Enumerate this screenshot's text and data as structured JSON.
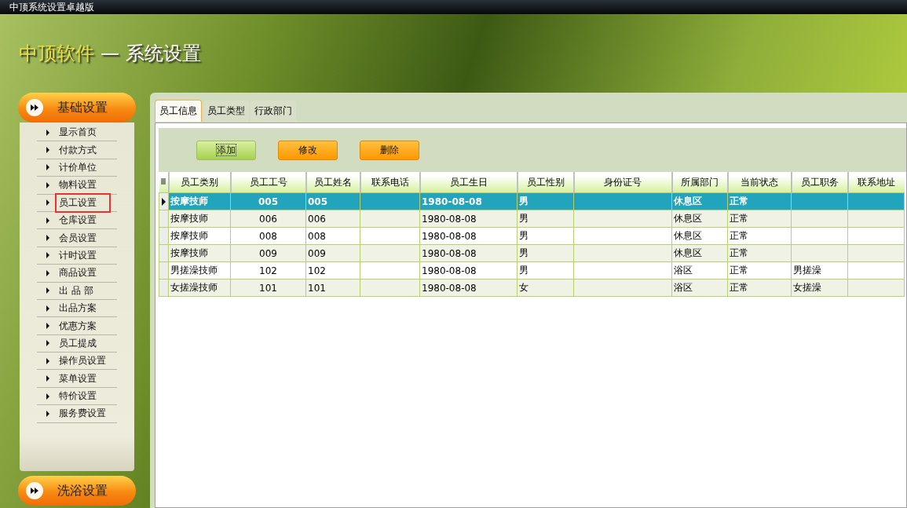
{
  "window": {
    "title": "中顶系统设置卓越版"
  },
  "header": {
    "brand": "中顶软件",
    "separator": "—",
    "subtitle": "系统设置"
  },
  "sidebar": {
    "top_group": {
      "label": "基础设置"
    },
    "bottom_group": {
      "label": "洗浴设置"
    },
    "items": [
      {
        "label": "显示首页",
        "selected": false
      },
      {
        "label": "付款方式",
        "selected": false
      },
      {
        "label": "计价单位",
        "selected": false
      },
      {
        "label": "物料设置",
        "selected": false
      },
      {
        "label": "员工设置",
        "selected": true
      },
      {
        "label": "仓库设置",
        "selected": false
      },
      {
        "label": "会员设置",
        "selected": false
      },
      {
        "label": "计时设置",
        "selected": false
      },
      {
        "label": "商品设置",
        "selected": false
      },
      {
        "label": "出 品 部",
        "selected": false
      },
      {
        "label": "出品方案",
        "selected": false
      },
      {
        "label": "优惠方案",
        "selected": false
      },
      {
        "label": "员工提成",
        "selected": false
      },
      {
        "label": "操作员设置",
        "selected": false
      },
      {
        "label": "菜单设置",
        "selected": false
      },
      {
        "label": "特价设置",
        "selected": false
      },
      {
        "label": "服务费设置",
        "selected": false
      }
    ]
  },
  "tabs": [
    {
      "label": "员工信息",
      "selected": true
    },
    {
      "label": "员工类型",
      "selected": false
    },
    {
      "label": "行政部门",
      "selected": false
    }
  ],
  "toolbar": {
    "buttons": [
      {
        "label": "添加",
        "kind": "green",
        "focused": true
      },
      {
        "label": "修改",
        "kind": "orange",
        "focused": false
      },
      {
        "label": "删除",
        "kind": "orange",
        "focused": false
      }
    ]
  },
  "table": {
    "columns": [
      "员工类别",
      "员工工号",
      "员工姓名",
      "联系电话",
      "员工生日",
      "员工性别",
      "身份证号",
      "所属部门",
      "当前状态",
      "员工职务",
      "联系地址"
    ],
    "rows": [
      {
        "selected": true,
        "cells": [
          "按摩技师",
          "005",
          "005",
          "",
          "1980-08-08",
          "男",
          "",
          "休息区",
          "正常",
          "",
          ""
        ]
      },
      {
        "selected": false,
        "cells": [
          "按摩技师",
          "006",
          "006",
          "",
          "1980-08-08",
          "男",
          "",
          "休息区",
          "正常",
          "",
          ""
        ]
      },
      {
        "selected": false,
        "cells": [
          "按摩技师",
          "008",
          "008",
          "",
          "1980-08-08",
          "男",
          "",
          "休息区",
          "正常",
          "",
          ""
        ]
      },
      {
        "selected": false,
        "cells": [
          "按摩技师",
          "009",
          "009",
          "",
          "1980-08-08",
          "男",
          "",
          "休息区",
          "正常",
          "",
          ""
        ]
      },
      {
        "selected": false,
        "cells": [
          "男搓澡技师",
          "102",
          "102",
          "",
          "1980-08-08",
          "男",
          "",
          "浴区",
          "正常",
          "男搓澡",
          ""
        ]
      },
      {
        "selected": false,
        "cells": [
          "女搓澡技师",
          "101",
          "101",
          "",
          "1980-08-08",
          "女",
          "",
          "浴区",
          "正常",
          "女搓澡",
          ""
        ]
      }
    ]
  }
}
